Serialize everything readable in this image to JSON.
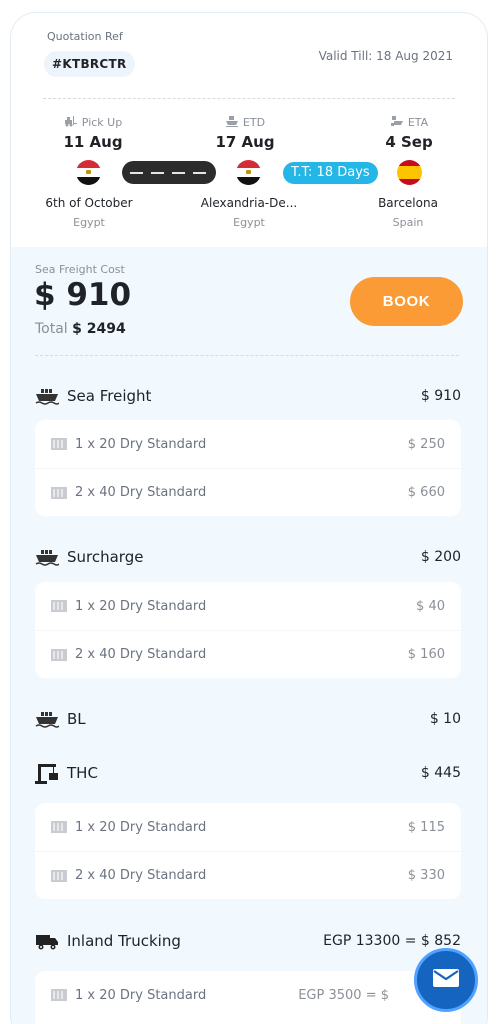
{
  "quote": {
    "label": "Quotation Ref",
    "ref": "#KTBRCTR",
    "valid_till": "Valid Till: 18 Aug 2021"
  },
  "route": {
    "pickup": {
      "label": "Pick Up",
      "date": "11 Aug",
      "city": "6th of October",
      "country": "Egypt"
    },
    "etd": {
      "label": "ETD",
      "date": "17 Aug",
      "city": "Alexandria-De...",
      "country": "Egypt"
    },
    "eta": {
      "label": "ETA",
      "date": "4 Sep",
      "city": "Barcelona",
      "country": "Spain"
    },
    "transit": "T.T: 18 Days"
  },
  "price": {
    "label": "Sea Freight Cost",
    "amount": "$ 910",
    "total_label": "Total",
    "total_value": "$ 2494",
    "book": "BOOK"
  },
  "sections": {
    "sea": {
      "title": "Sea Freight",
      "amount": "$ 910",
      "items": [
        {
          "label": "1 x 20 Dry Standard",
          "value": "$ 250"
        },
        {
          "label": "2 x 40 Dry Standard",
          "value": "$ 660"
        }
      ]
    },
    "surcharge": {
      "title": "Surcharge",
      "amount": "$ 200",
      "items": [
        {
          "label": "1 x 20 Dry Standard",
          "value": "$ 40"
        },
        {
          "label": "2 x 40 Dry Standard",
          "value": "$ 160"
        }
      ]
    },
    "bl": {
      "title": "BL",
      "amount": "$ 10"
    },
    "thc": {
      "title": "THC",
      "amount": "$ 445",
      "items": [
        {
          "label": "1 x 20 Dry Standard",
          "value": "$ 115"
        },
        {
          "label": "2 x 40 Dry Standard",
          "value": "$ 330"
        }
      ]
    },
    "inland": {
      "title": "Inland Trucking",
      "amount": "EGP 13300 = $ 852",
      "items": [
        {
          "label": "1 x 20 Dry Standard",
          "value": "EGP 3500 = $"
        }
      ]
    }
  },
  "colors": {
    "accent_orange": "#fb9b36",
    "transit_blue": "#24b6e6",
    "fab_blue": "#1565c0",
    "panel_bg": "#f1f8fe"
  },
  "icons": [
    "truck-icon",
    "ship-icon",
    "container-icon",
    "crane-icon",
    "mail-icon"
  ]
}
